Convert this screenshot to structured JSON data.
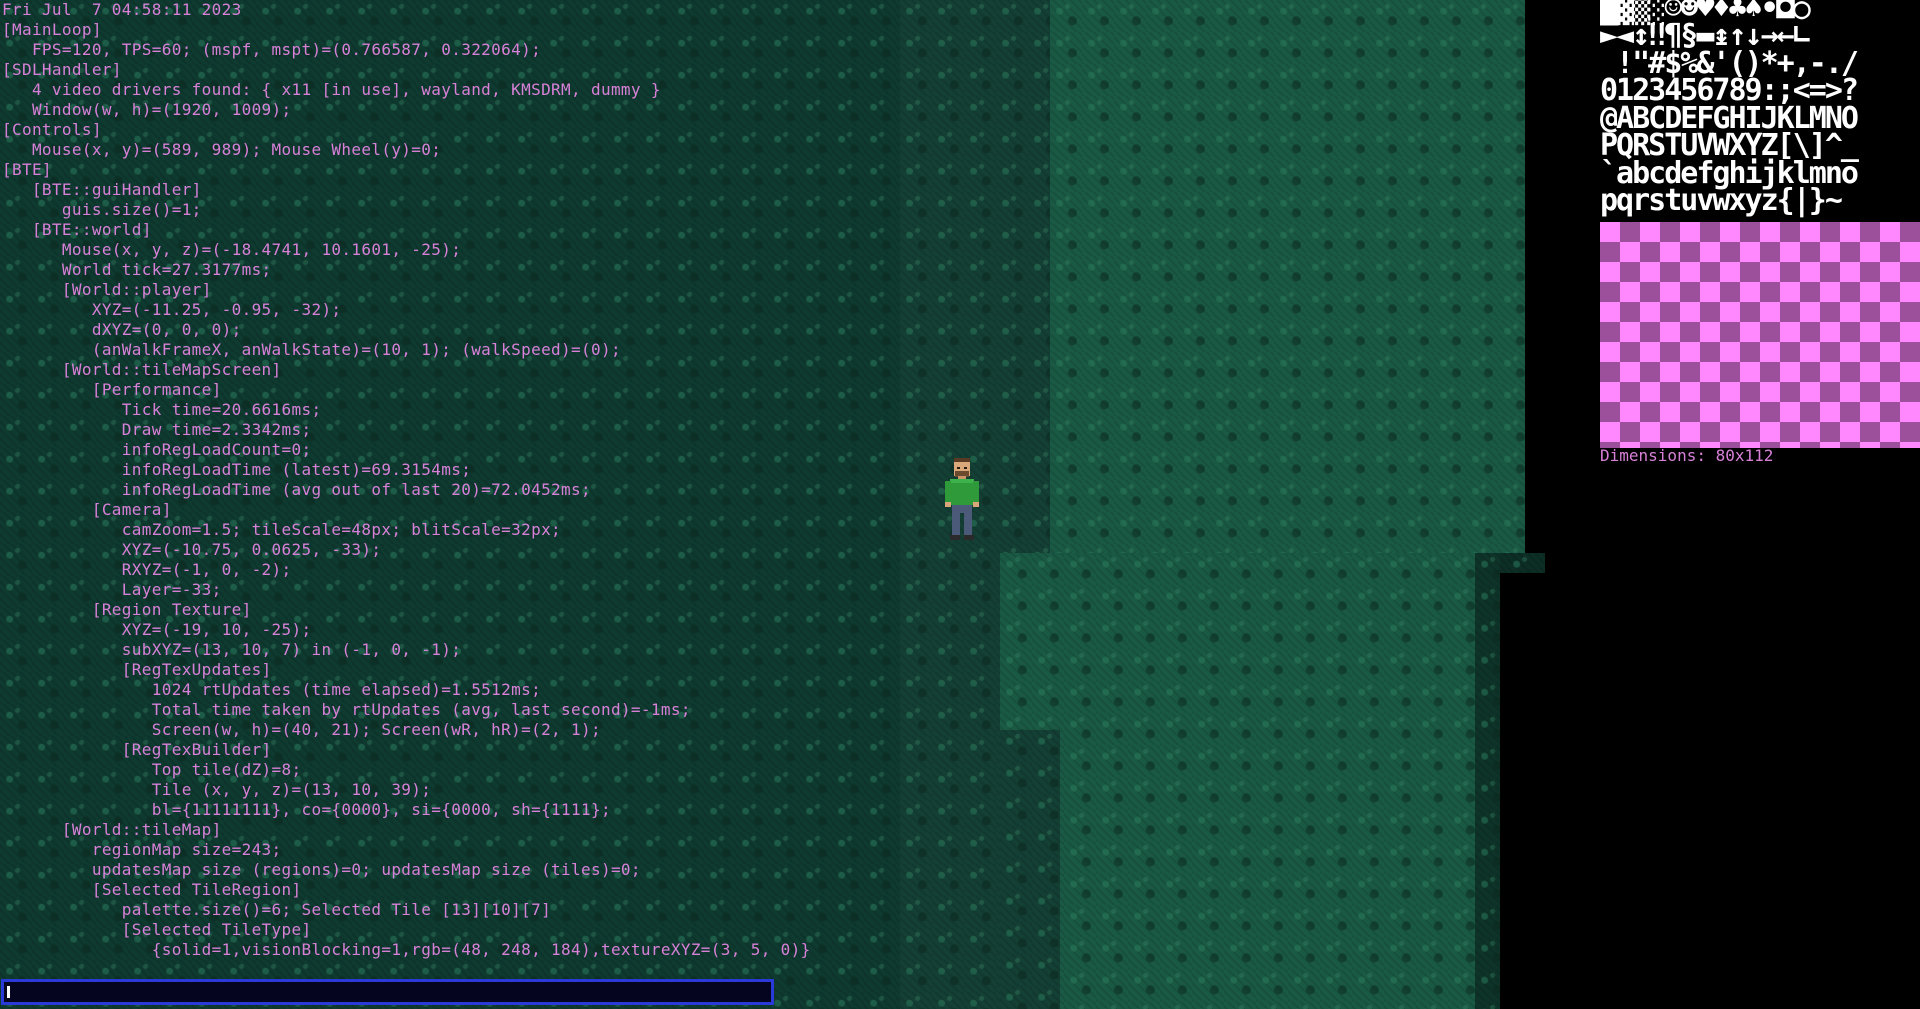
{
  "timestamp": "Fri Jul  7 04:58:11 2023",
  "debug_lines": [
    "[MainLoop]",
    "   FPS=120, TPS=60; (mspf, mspt)=(0.766587, 0.322064);",
    "[SDLHandler]",
    "   4 video drivers found: { x11 [in use], wayland, KMSDRM, dummy }",
    "   Window(w, h)=(1920, 1009);",
    "[Controls]",
    "   Mouse(x, y)=(589, 989); Mouse Wheel(y)=0;",
    "[BTE]",
    "   [BTE::guiHandler]",
    "      guis.size()=1;",
    "   [BTE::world]",
    "      Mouse(x, y, z)=(-18.4741, 10.1601, -25);",
    "      World tick=27.3177ms;",
    "      [World::player]",
    "         XYZ=(-11.25, -0.95, -32);",
    "         dXYZ=(0, 0, 0);",
    "         (anWalkFrameX, anWalkState)=(10, 1); (walkSpeed)=(0);",
    "      [World::tileMapScreen]",
    "         [Performance]",
    "            Tick time=20.6616ms;",
    "            Draw time=2.3342ms;",
    "            infoRegLoadCount=0;",
    "            infoRegLoadTime (latest)=69.3154ms;",
    "            infoRegLoadTime (avg out of last 20)=72.0452ms;",
    "         [Camera]",
    "            camZoom=1.5; tileScale=48px; blitScale=32px;",
    "            XYZ=(-10.75, 0.0625, -33);",
    "            RXYZ=(-1, 0, -2);",
    "            Layer=-33;",
    "         [Region Texture]",
    "            XYZ=(-19, 10, -25);",
    "            subXYZ=(13, 10, 7) in (-1, 0, -1);",
    "            [RegTexUpdates]",
    "               1024 rtUpdates (time elapsed)=1.5512ms;",
    "               Total time taken by rtUpdates (avg, last second)=-1ms;",
    "               Screen(w, h)=(40, 21); Screen(wR, hR)=(2, 1);",
    "            [RegTexBuilder]",
    "               Top tile(dZ)=8;",
    "               Tile (x, y, z)=(13, 10, 39);",
    "               bl={11111111}, co={0000}, si={0000, sh={1111};",
    "      [World::tileMap]",
    "         regionMap size=243;",
    "         updatesMap size (regions)=0; updatesMap size (tiles)=0;",
    "         [Selected TileRegion]",
    "            palette.size()=6; Selected Tile [13][10][7]",
    "            [Selected TileType]",
    "               {solid=1,visionBlocking=1,rgb=(48, 248, 184),textureXYZ=(3, 5, 0)}"
  ],
  "texture_viewer": {
    "atlas_rows": [
      "█▓▒░☺☻♥♦♣♠•◘○",
      "►◄↕‼¶§▬↨↑↓→←∟",
      " !\"#$%&'()*+,-./",
      "0123456789:;<=>?",
      "@ABCDEFGHIJKLMNO",
      "PQRSTUVWXYZ[\\]^_",
      "`abcdefghijklmno",
      "pqrstuvwxyz{|}~"
    ],
    "dimensions": "Dimensions: 80x112"
  },
  "console": {
    "value": "",
    "placeholder": ""
  },
  "colors": {
    "overlay_text": "#d880d8",
    "console_border": "#2a3ad8",
    "checker_light": "#ff88ff",
    "checker_dark": "#9c509c",
    "terrain": "#1a5a45"
  },
  "icons": {
    "player": "player-character-sprite"
  }
}
